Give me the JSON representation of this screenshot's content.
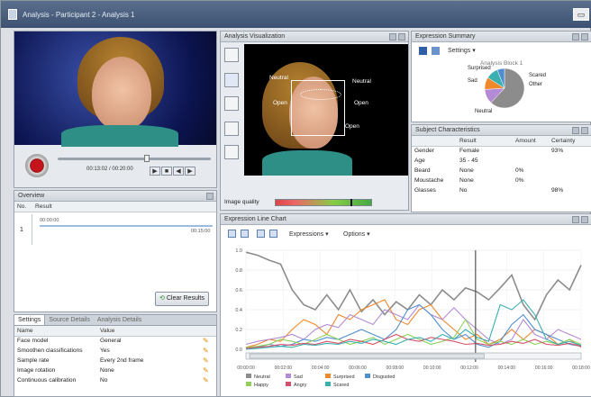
{
  "window": {
    "title": "Analysis - Participant 2 - Analysis 1"
  },
  "overview": {
    "title": "Overview",
    "col_no": "No.",
    "col_result": "Result",
    "row_no": "1",
    "time_start": "00:00:00",
    "time_end": "00:15:00",
    "clear_label": "Clear Results"
  },
  "player": {
    "time": "00:13:02 / 00:20:00"
  },
  "visualization": {
    "title": "Analysis Visualization",
    "labels": [
      "Neutral",
      "Neutral",
      "Open",
      "Open",
      "Open"
    ],
    "image_quality_label": "Image quality",
    "image_quality": 0.78
  },
  "summary": {
    "title": "Expression Summary",
    "settings_label": "Settings",
    "chart_title": "Analysis Block 1",
    "labels": [
      "Surprised",
      "Sad",
      "Scared",
      "Other",
      "Neutral"
    ]
  },
  "subject": {
    "title": "Subject Characteristics",
    "headers": [
      "",
      "Result",
      "Amount",
      "Certainty"
    ],
    "rows": [
      [
        "Gender",
        "Female",
        "",
        "93%"
      ],
      [
        "Age",
        "35 - 45",
        "",
        ""
      ],
      [
        "Beard",
        "None",
        "0%",
        ""
      ],
      [
        "Moustache",
        "None",
        "0%",
        ""
      ],
      [
        "Glasses",
        "No",
        "",
        "98%"
      ]
    ]
  },
  "settings": {
    "tabs": [
      "Settings",
      "Source Details",
      "Analysis Details"
    ],
    "headers": [
      "Name",
      "Value"
    ],
    "rows": [
      [
        "Face model",
        "General"
      ],
      [
        "Smoothen classifications",
        "Yes"
      ],
      [
        "Sample rate",
        "Every 2nd frame"
      ],
      [
        "Image rotation",
        "None"
      ],
      [
        "Continuous calibration",
        "No"
      ]
    ]
  },
  "line_chart": {
    "title": "Expression Line Chart",
    "expressions_label": "Expressions",
    "options_label": "Options"
  },
  "chart_data": {
    "type": "line",
    "ylim": [
      0,
      1
    ],
    "yticks": [
      "1.0",
      "0.8",
      "0.6",
      "0.4",
      "0.2",
      "0.0"
    ],
    "x": [
      "00:00:00",
      "00:02:00",
      "00:04:00",
      "00:06:00",
      "00:08:00",
      "00:10:00",
      "00:12:00",
      "00:14:00",
      "00:16:00",
      "00:18:00"
    ],
    "legend": [
      "Neutral",
      "Sad",
      "Surprised",
      "Disgusted",
      "Happy",
      "Angry",
      "Scared"
    ],
    "colors": {
      "Neutral": "#8c8c8c",
      "Sad": "#b38ad6",
      "Surprised": "#f0882c",
      "Disgusted": "#4f8fd0",
      "Happy": "#8fcf5a",
      "Angry": "#d94e6a",
      "Scared": "#3ab0b0"
    },
    "series": [
      {
        "name": "Neutral",
        "values": [
          0.98,
          0.95,
          0.9,
          0.86,
          0.6,
          0.45,
          0.4,
          0.55,
          0.4,
          0.6,
          0.38,
          0.5,
          0.35,
          0.48,
          0.4,
          0.55,
          0.45,
          0.6,
          0.5,
          0.62,
          0.58,
          0.5,
          0.62,
          0.75,
          0.45,
          0.3,
          0.55,
          0.7,
          0.6,
          0.85
        ]
      },
      {
        "name": "Surprised",
        "values": [
          0.02,
          0.05,
          0.1,
          0.08,
          0.2,
          0.3,
          0.25,
          0.15,
          0.35,
          0.3,
          0.4,
          0.45,
          0.5,
          0.3,
          0.25,
          0.4,
          0.45,
          0.3,
          0.2,
          0.1,
          0.15,
          0.05,
          0.1,
          0.2,
          0.1,
          0.2,
          0.15,
          0.05,
          0.1,
          0.02
        ]
      },
      {
        "name": "Sad",
        "values": [
          0.05,
          0.08,
          0.1,
          0.12,
          0.15,
          0.1,
          0.2,
          0.25,
          0.22,
          0.35,
          0.3,
          0.25,
          0.4,
          0.35,
          0.3,
          0.45,
          0.35,
          0.3,
          0.42,
          0.3,
          0.2,
          0.1,
          0.05,
          0.1,
          0.3,
          0.15,
          0.1,
          0.2,
          0.15,
          0.1
        ]
      },
      {
        "name": "Disgusted",
        "values": [
          0.0,
          0.02,
          0.05,
          0.03,
          0.05,
          0.1,
          0.08,
          0.12,
          0.1,
          0.15,
          0.2,
          0.15,
          0.1,
          0.2,
          0.4,
          0.45,
          0.35,
          0.2,
          0.1,
          0.15,
          0.05,
          0.02,
          0.08,
          0.25,
          0.35,
          0.2,
          0.15,
          0.1,
          0.05,
          0.03
        ]
      },
      {
        "name": "Happy",
        "values": [
          0.02,
          0.03,
          0.05,
          0.1,
          0.08,
          0.05,
          0.1,
          0.15,
          0.1,
          0.05,
          0.08,
          0.12,
          0.05,
          0.1,
          0.15,
          0.1,
          0.05,
          0.08,
          0.12,
          0.3,
          0.1,
          0.05,
          0.08,
          0.05,
          0.1,
          0.05,
          0.08,
          0.05,
          0.1,
          0.05
        ]
      },
      {
        "name": "Angry",
        "values": [
          0.01,
          0.02,
          0.03,
          0.05,
          0.04,
          0.06,
          0.05,
          0.08,
          0.06,
          0.1,
          0.08,
          0.05,
          0.1,
          0.15,
          0.1,
          0.08,
          0.12,
          0.1,
          0.08,
          0.05,
          0.06,
          0.04,
          0.05,
          0.08,
          0.06,
          0.1,
          0.05,
          0.04,
          0.06,
          0.03
        ]
      },
      {
        "name": "Scared",
        "values": [
          0.0,
          0.01,
          0.02,
          0.03,
          0.02,
          0.05,
          0.04,
          0.06,
          0.05,
          0.08,
          0.06,
          0.1,
          0.08,
          0.05,
          0.1,
          0.12,
          0.08,
          0.15,
          0.1,
          0.2,
          0.12,
          0.08,
          0.45,
          0.4,
          0.5,
          0.35,
          0.1,
          0.05,
          0.08,
          0.04
        ]
      }
    ]
  },
  "pie_data": {
    "type": "pie",
    "labels": [
      "Neutral",
      "Sad",
      "Surprised",
      "Scared",
      "Other"
    ],
    "values": [
      62,
      12,
      10,
      10,
      6
    ],
    "colors": [
      "#8c8c8c",
      "#b38ad6",
      "#f0882c",
      "#3ab0b0",
      "#4f8fd0"
    ]
  }
}
